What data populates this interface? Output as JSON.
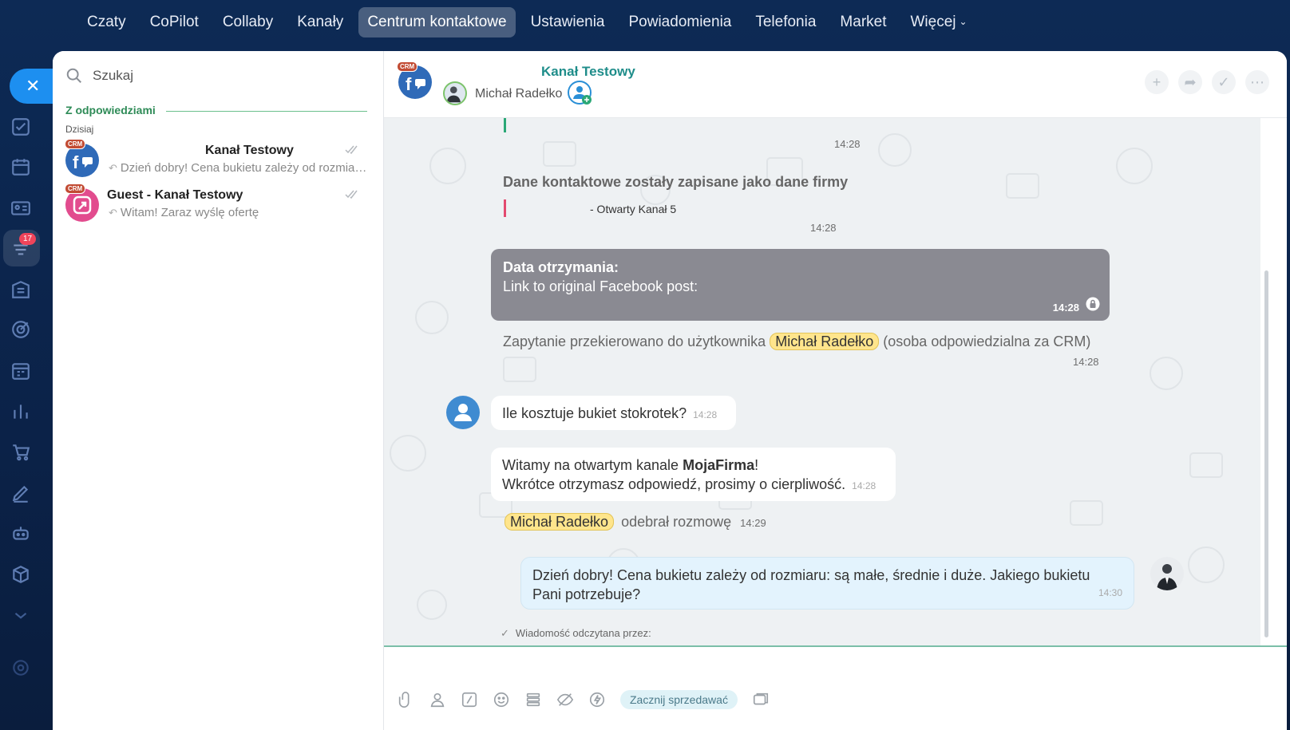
{
  "topnav": {
    "items": [
      {
        "label": "Czaty"
      },
      {
        "label": "CoPilot"
      },
      {
        "label": "Collaby"
      },
      {
        "label": "Kanały"
      },
      {
        "label": "Centrum kontaktowe"
      },
      {
        "label": "Ustawienia"
      },
      {
        "label": "Powiadomienia"
      },
      {
        "label": "Telefonia"
      },
      {
        "label": "Market"
      },
      {
        "label": "Więcej"
      }
    ],
    "active_index": 4
  },
  "rail": {
    "badge_count": "17",
    "icons": [
      "tasks-icon",
      "calendar-icon",
      "contact-card-icon",
      "contact-center-icon",
      "building-icon",
      "target-icon",
      "planner-icon",
      "analytics-icon",
      "cart-icon",
      "pen-icon",
      "robot-icon",
      "cube-icon",
      "chevron-down-icon",
      "settings-icon"
    ]
  },
  "sidebar": {
    "search_placeholder": "Szukaj",
    "section_title": "Z odpowiedziami",
    "day_label": "Dzisiaj",
    "chats": [
      {
        "crm": "CRM",
        "title": "Kanał Testowy",
        "preview": "Dzień dobry! Cena bukietu zależy od rozmiaru: są małe, średnie i duże. Jakiego bukietu Pani potrzebuje?"
      },
      {
        "crm": "CRM",
        "title": "Guest - Kanał Testowy",
        "preview": "Witam! Zaraz wyślę ofertę"
      }
    ]
  },
  "header": {
    "crm": "CRM",
    "title": "Kanał Testowy",
    "user": "Michał Radełko"
  },
  "messages": {
    "time1": "14:28",
    "sys1_title": "Dane kontaktowe zostały zapisane jako dane firmy",
    "sys1_quote": "- Otwarty Kanał 5",
    "time2": "14:28",
    "card_title": "Data otrzymania:",
    "card_text": "Link to original Facebook post:",
    "card_time": "14:28",
    "redirect_text": "Zapytanie przekierowano do użytkownika",
    "redirect_user": "Michał Radełko",
    "redirect_suffix": "(osoba odpowiedzialna za CRM)",
    "redirect_time": "14:28",
    "client_msg": "Ile kosztuje bukiet stokrotek?",
    "client_time": "14:28",
    "welcome_pre": "Witamy na otwartym kanale ",
    "welcome_brand": "MojaFirma",
    "welcome_post": "!",
    "welcome_line2": "Wkrótce otrzymasz odpowiedź, prosimy o cierpliwość.",
    "welcome_time": "14:28",
    "taken_user": "Michał Radełko",
    "taken_text": "odebrał rozmowę",
    "taken_time": "14:29",
    "reply_text": "Dzień dobry! Cena bukietu zależy od rozmiaru: są małe, średnie i duże. Jakiego bukietu Pani potrzebuje?",
    "reply_time": "14:30",
    "read_by": "Wiadomość odczytana przez:"
  },
  "composer": {
    "sell_button": "Zacznij sprzedawać"
  },
  "colors": {
    "accent": "#1d8ff0",
    "header_title": "#1f8d8a",
    "mention_bg": "#ffe58c"
  }
}
